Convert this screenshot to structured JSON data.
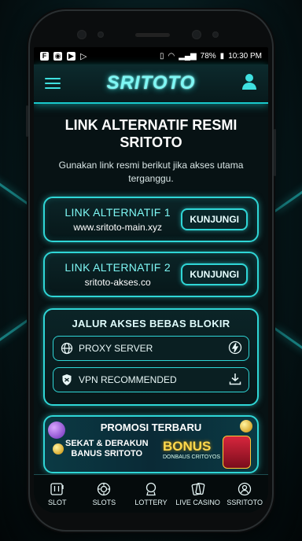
{
  "status_bar": {
    "battery": "78%",
    "time": "10:30 PM"
  },
  "header": {
    "brand": "SRITOTO"
  },
  "page": {
    "title": "LINK ALTERNATIF RESMI SRITOTO",
    "subtitle": "Gunakan link resmi berikut jika akses utama terganggu."
  },
  "links": [
    {
      "label": "LINK ALTERNATIF 1",
      "url": "www.sritoto-main.xyz",
      "button": "KUNJUNGI"
    },
    {
      "label": "LINK ALTERNATIF 2",
      "url": "sritoto-akses.co",
      "button": "KUNJUNGI"
    }
  ],
  "access": {
    "title": "JALUR AKSES BEBAS BLOKIR",
    "options": [
      {
        "label": "PROXY SERVER",
        "icon": "globe-icon",
        "action_icon": "lightning-icon"
      },
      {
        "label": "VPN RECOMMENDED",
        "icon": "shield-icon",
        "action_icon": "download-icon"
      }
    ]
  },
  "promo": {
    "title": "PROMOSI TERBARU",
    "left_line1": "SEKAT & DERAKUN",
    "left_line2": "BANUS SRITOTO",
    "right_big": "BONUS",
    "right_small": "DONBAUS CRITOYOS"
  },
  "bottom_nav": [
    {
      "label": "SLOT",
      "icon": "slot-machine-icon"
    },
    {
      "label": "SLOTS",
      "icon": "chip-icon"
    },
    {
      "label": "LOTTERY",
      "icon": "lottery-icon"
    },
    {
      "label": "LIVE CASINO",
      "icon": "cards-icon"
    },
    {
      "label": "SSRITOTO",
      "icon": "profile-icon"
    }
  ],
  "colors": {
    "accent": "#2fd6d6",
    "brand_glow": "#7ef7f4",
    "background": "#071214"
  }
}
